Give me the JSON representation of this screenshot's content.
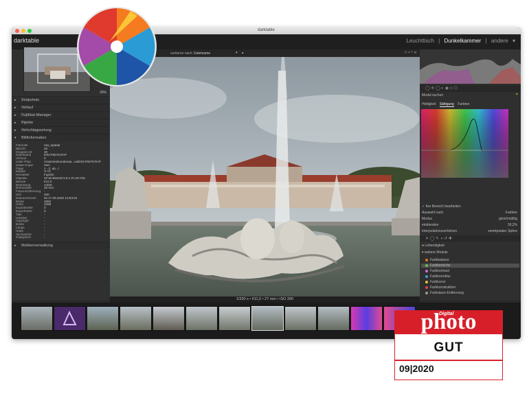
{
  "window": {
    "title": "darktable"
  },
  "app": {
    "name": "darktable"
  },
  "views": {
    "lighttable": "Leuchttisch",
    "darkroom": "Dunkelkammer",
    "other": "andere",
    "sep": "|"
  },
  "toolbar": {
    "sort_label": "sortieren nach",
    "sort_value": "Dateiname"
  },
  "navigation": {
    "zoom": "39%"
  },
  "left_sections": [
    "Snapshots",
    "Verlauf",
    "Duplikat-Manager",
    "Pipette",
    "Verschlagwortung",
    "Bildinformation"
  ],
  "info": [
    {
      "k": "Filmrolle",
      "v": "raw_spatial"
    },
    {
      "k": "Bild-ID",
      "v": "20"
    },
    {
      "k": "Gruppen-ID",
      "v": "20"
    },
    {
      "k": "Dateiname",
      "v": "DSCF6578.RAF"
    },
    {
      "k": "Version",
      "v": "0"
    },
    {
      "k": "voller Pfad",
      "v": "/Volumes/kundenda...ial/DSCF6578.RAF"
    },
    {
      "k": "lokale Kopie",
      "v": "nein"
    },
    {
      "k": "Flags",
      "v": "1 - 2, ab...r"
    },
    {
      "k": "Modell",
      "v": "X-T1"
    },
    {
      "k": "Hersteller",
      "v": "Fujifilm"
    },
    {
      "k": "Objektiv",
      "v": "XF18-55mmF2.8-4 R LM OIS"
    },
    {
      "k": "Blende",
      "v": "f/11.0"
    },
    {
      "k": "Belichtung",
      "v": "1/320"
    },
    {
      "k": "Brennweite",
      "v": "26 mm"
    },
    {
      "k": "Fokus-Entfernung",
      "v": "-"
    },
    {
      "k": "ISO",
      "v": "200"
    },
    {
      "k": "Datum/Uhrzeit",
      "v": "Mi 17.06.2020 10:53:04"
    },
    {
      "k": "Breite",
      "v": "4992"
    },
    {
      "k": "Höhe",
      "v": "3296"
    },
    {
      "k": "Exportbreite",
      "v": "0"
    },
    {
      "k": "Exporthöhe",
      "v": "0"
    },
    {
      "k": "Titel",
      "v": "-"
    },
    {
      "k": "Urheber",
      "v": "-"
    },
    {
      "k": "copyright",
      "v": "-"
    },
    {
      "k": "Breite",
      "v": "-"
    },
    {
      "k": "Länge",
      "v": "-"
    },
    {
      "k": "Höhe",
      "v": "-"
    },
    {
      "k": "Stichwörter",
      "v": "-"
    },
    {
      "k": "Kategorien",
      "v": "-"
    }
  ],
  "bottom_section": "Maskenverwaltung",
  "statusline": "1/320 s • f/11,0 • 27 mm • ISO 200",
  "right": {
    "search_label": "Modul suchen",
    "tabs": [
      "Helligkeit",
      "Sättigung",
      "Farbton"
    ],
    "edit_area": "fixe Bereich bearbeiten",
    "rows": [
      {
        "label": "Auswahl nach",
        "value": "Farbton"
      },
      {
        "label": "Modus",
        "value": "gleichmäßig"
      },
      {
        "label": "einblenden",
        "value": "39,2%"
      },
      {
        "label": "Interpolationsverfahren",
        "value": "zentripetaler Spline"
      }
    ],
    "module_active": "Lebendigkeit",
    "more_modules": "weitere Module",
    "modules": [
      "Farbbalance",
      "Farbbereiche",
      "Farbkontrast",
      "Farbkorrektur",
      "Farbkurve",
      "Farbkonstruktion",
      "Farbsäure-Entfernung"
    ],
    "module_bullets": [
      "#dd7b22",
      "#6cbf4a",
      "#c86fd0",
      "#3aa0e0",
      "#e2c430",
      "#dd4444",
      "#999999"
    ]
  },
  "badge": {
    "digital": "Digital",
    "brand": "photo",
    "rating": "GUT",
    "date": "09|2020",
    "color": "#d71f2a"
  },
  "colors": {
    "accent": "#f0c020",
    "window_bg": "#2a2a2a"
  }
}
